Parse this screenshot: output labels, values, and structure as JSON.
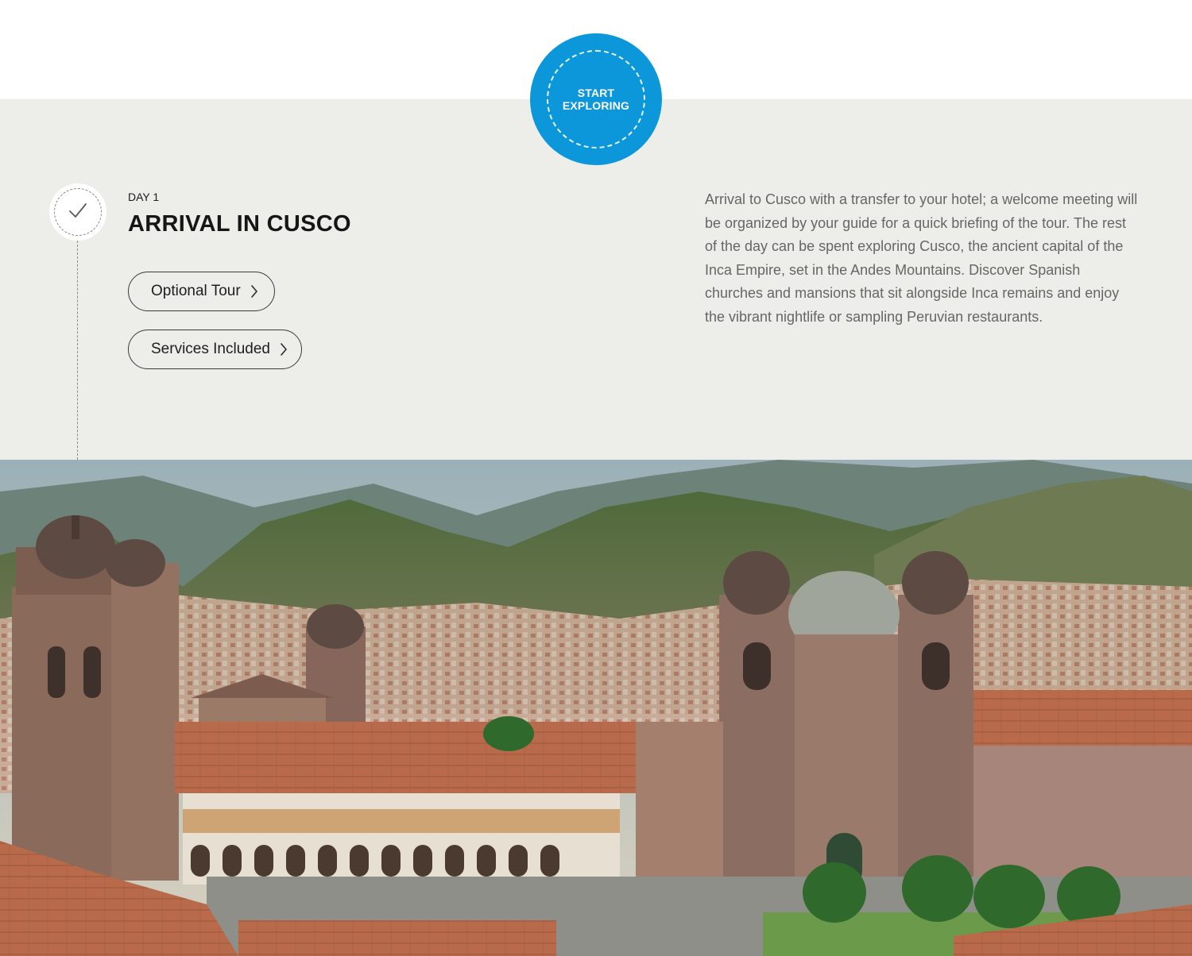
{
  "start": {
    "label_line1": "START",
    "label_line2": "EXPLORING"
  },
  "day": {
    "label": "DAY 1",
    "title": "ARRIVAL IN CUSCO",
    "buttons": {
      "optional_tour": "Optional Tour",
      "services_included": "Services Included"
    },
    "description": "Arrival to Cusco with a transfer to your hotel; a welcome meeting will be organized by your guide for a quick briefing of the tour. The rest of the day can be spent exploring Cusco, the ancient capital of the Inca Empire, set in the Andes Mountains. Discover Spanish churches and mansions that sit alongside Inca remains and enjoy the vibrant nightlife or sampling Peruvian restaurants."
  },
  "icons": {
    "check": "check-icon",
    "chevron": "chevron-right-icon"
  },
  "colors": {
    "accent_blue": "#0d97db",
    "band_grey": "#ededea",
    "text_dark": "#161616",
    "text_body": "#666666"
  }
}
